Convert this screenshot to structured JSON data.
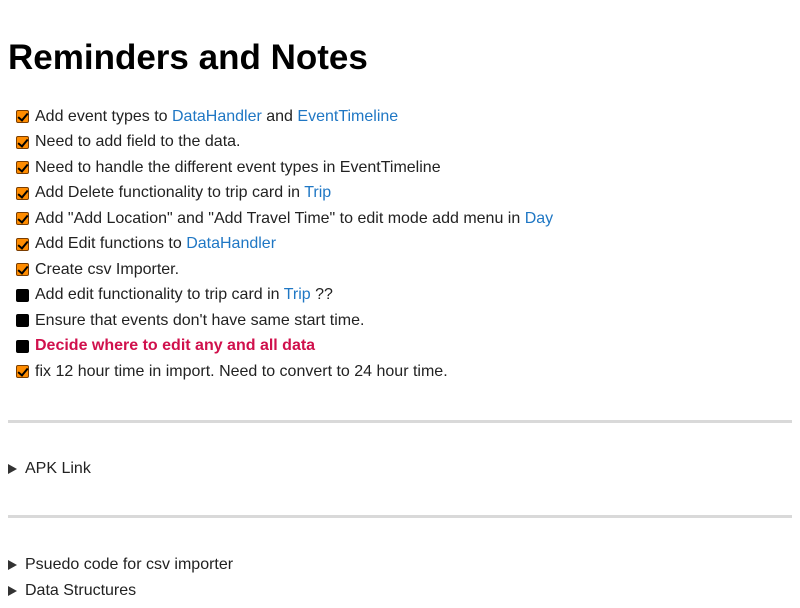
{
  "page": {
    "title": "Reminders and Notes"
  },
  "tasks": [
    {
      "checked": true,
      "parts": [
        "Add event types to ",
        "DataHandler",
        " and ",
        "EventTimeline"
      ]
    },
    {
      "checked": true,
      "text": "Need to add field to the data."
    },
    {
      "checked": true,
      "text": "Need to handle the different event types in EventTimeline"
    },
    {
      "checked": true,
      "parts": [
        "Add Delete functionality to trip card in ",
        "Trip"
      ]
    },
    {
      "checked": true,
      "parts": [
        "Add \"Add Location\" and \"Add Travel Time\" to edit mode add menu in ",
        "Day"
      ]
    },
    {
      "checked": true,
      "parts": [
        "Add Edit functions to ",
        "DataHandler"
      ]
    },
    {
      "checked": true,
      "text": "Create csv Importer."
    },
    {
      "checked": false,
      "parts": [
        "Add edit functionality to trip card in ",
        "Trip",
        " ??"
      ]
    },
    {
      "checked": false,
      "text": "Ensure that events don't have same start time."
    },
    {
      "checked": false,
      "text": "Decide where to edit any and all data"
    },
    {
      "checked": true,
      "text": "fix 12 hour time in import. Need to convert to 24 hour time."
    }
  ],
  "sections": {
    "apk_link": "APK Link",
    "pseudo_code": "Psuedo code for csv importer",
    "data_structures": "Data Structures"
  },
  "colors": {
    "link": "#1f77c4",
    "important": "#d0104c",
    "checkbox_checked": "#ff8c00"
  }
}
